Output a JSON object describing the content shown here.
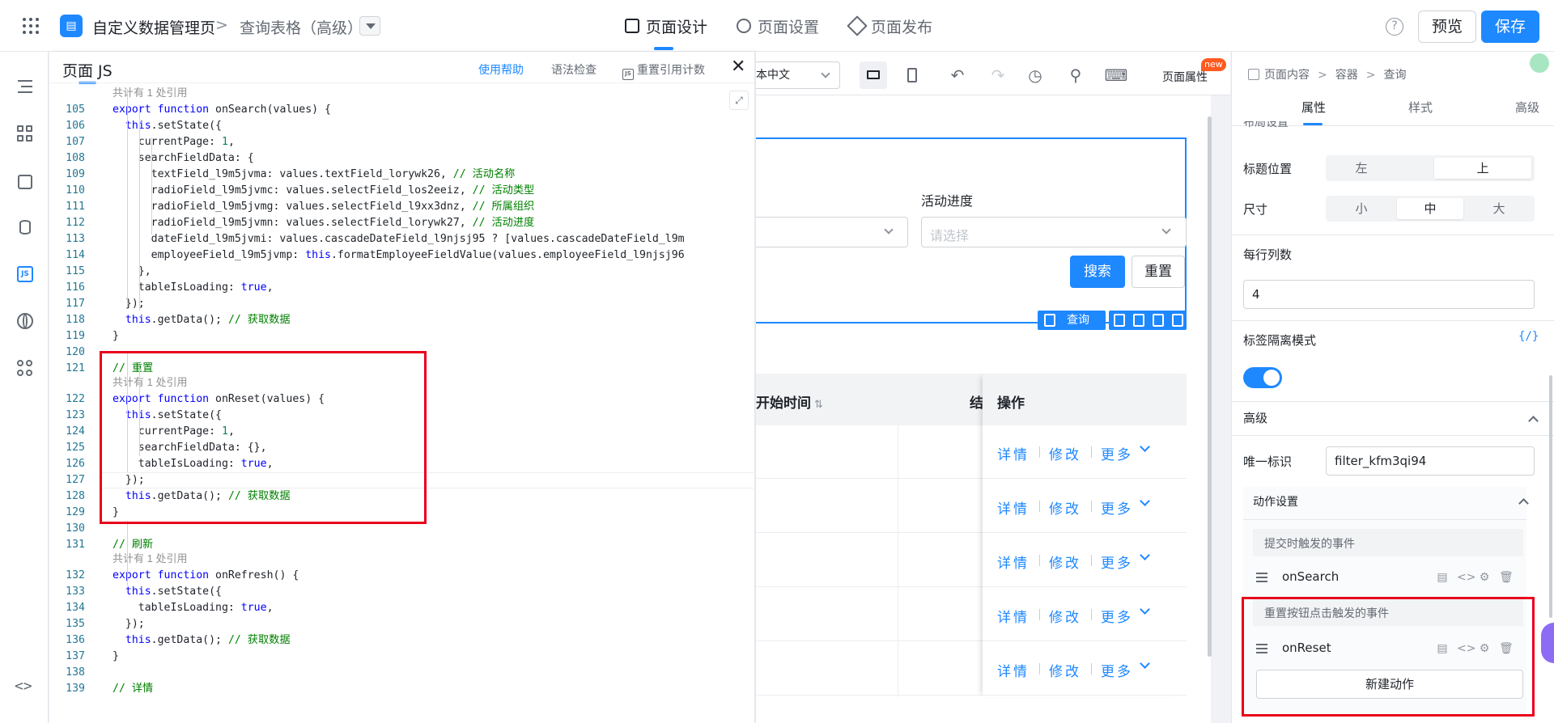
{
  "header": {
    "app_name": "自定义数据管理页",
    "breadcrumb_sep": ">",
    "page_name": "查询表格（高级）",
    "nav": [
      {
        "label": "页面设计",
        "active": true
      },
      {
        "label": "页面设置",
        "active": false
      },
      {
        "label": "页面发布",
        "active": false
      }
    ],
    "help": "?",
    "preview_label": "预览",
    "save_label": "保存"
  },
  "rail": {
    "js_label": "JS",
    "code_label": "<>"
  },
  "code_panel": {
    "title": "页面 JS",
    "help_link": "使用帮助",
    "syntax_check": "语法检查",
    "reset_ref_count": "重置引用计数",
    "js_badge": "JS",
    "close": "✕",
    "lines": [
      {
        "lens": "共计有 1 处引用",
        "n": "105",
        "parts": [
          [
            "k",
            "export function "
          ],
          [
            "t",
            "onSearch(values) {"
          ]
        ]
      },
      {
        "n": "106",
        "parts": [
          [
            "t",
            "  "
          ],
          [
            "k",
            "this"
          ],
          [
            "t",
            ".setState({"
          ]
        ]
      },
      {
        "n": "107",
        "parts": [
          [
            "t",
            "    currentPage: "
          ],
          [
            "n",
            "1"
          ],
          [
            "t",
            ","
          ]
        ]
      },
      {
        "n": "108",
        "parts": [
          [
            "t",
            "    searchFieldData: {"
          ]
        ]
      },
      {
        "n": "109",
        "parts": [
          [
            "t",
            "      textField_l9m5jvma: values.textField_lorywk26, "
          ],
          [
            "c",
            "// 活动名称"
          ]
        ]
      },
      {
        "n": "110",
        "parts": [
          [
            "t",
            "      radioField_l9m5jvmc: values.selectField_los2eeiz, "
          ],
          [
            "c",
            "// 活动类型"
          ]
        ]
      },
      {
        "n": "111",
        "parts": [
          [
            "t",
            "      radioField_l9m5jvmg: values.selectField_l9xx3dnz, "
          ],
          [
            "c",
            "// 所属组织"
          ]
        ]
      },
      {
        "n": "112",
        "parts": [
          [
            "t",
            "      radioField_l9m5jvmn: values.selectField_lorywk27, "
          ],
          [
            "c",
            "// 活动进度"
          ]
        ]
      },
      {
        "n": "113",
        "parts": [
          [
            "t",
            "      dateField_l9m5jvmi: values.cascadeDateField_l9njsj95 ? [values.cascadeDateField_l9m"
          ]
        ]
      },
      {
        "n": "114",
        "parts": [
          [
            "t",
            "      employeeField_l9m5jvmp: "
          ],
          [
            "k",
            "this"
          ],
          [
            "t",
            ".formatEmployeeFieldValue(values.employeeField_l9njsj96"
          ]
        ]
      },
      {
        "n": "115",
        "parts": [
          [
            "t",
            "    },"
          ]
        ]
      },
      {
        "n": "116",
        "parts": [
          [
            "t",
            "    tableIsLoading: "
          ],
          [
            "k",
            "true"
          ],
          [
            "t",
            ","
          ]
        ]
      },
      {
        "n": "117",
        "parts": [
          [
            "t",
            "  });"
          ]
        ]
      },
      {
        "n": "118",
        "parts": [
          [
            "t",
            "  "
          ],
          [
            "k",
            "this"
          ],
          [
            "t",
            ".getData(); "
          ],
          [
            "c",
            "// 获取数据"
          ]
        ]
      },
      {
        "n": "119",
        "parts": [
          [
            "t",
            "}"
          ]
        ]
      },
      {
        "n": "120",
        "parts": []
      },
      {
        "n": "121",
        "parts": [
          [
            "c",
            "// 重置"
          ]
        ]
      },
      {
        "lens": "共计有 1 处引用",
        "n": "122",
        "parts": [
          [
            "k",
            "export function "
          ],
          [
            "t",
            "onReset(values) {"
          ]
        ]
      },
      {
        "n": "123",
        "parts": [
          [
            "t",
            "  "
          ],
          [
            "k",
            "this"
          ],
          [
            "t",
            ".setState({"
          ]
        ]
      },
      {
        "n": "124",
        "parts": [
          [
            "t",
            "    currentPage: "
          ],
          [
            "n",
            "1"
          ],
          [
            "t",
            ","
          ]
        ]
      },
      {
        "n": "125",
        "parts": [
          [
            "t",
            "    searchFieldData: {},"
          ]
        ]
      },
      {
        "n": "126",
        "parts": [
          [
            "t",
            "    tableIsLoading: "
          ],
          [
            "k",
            "true"
          ],
          [
            "t",
            ","
          ]
        ]
      },
      {
        "n": "127",
        "parts": [
          [
            "t",
            "  });"
          ]
        ]
      },
      {
        "n": "128",
        "parts": [
          [
            "t",
            "  "
          ],
          [
            "k",
            "this"
          ],
          [
            "t",
            ".getData(); "
          ],
          [
            "c",
            "// 获取数据"
          ]
        ]
      },
      {
        "n": "129",
        "parts": [
          [
            "t",
            "}"
          ]
        ]
      },
      {
        "n": "130",
        "parts": []
      },
      {
        "n": "131",
        "parts": [
          [
            "c",
            "// 刷新"
          ]
        ]
      },
      {
        "lens": "共计有 1 处引用",
        "n": "132",
        "parts": [
          [
            "k",
            "export function "
          ],
          [
            "t",
            "onRefresh() {"
          ]
        ]
      },
      {
        "n": "133",
        "parts": [
          [
            "t",
            "  "
          ],
          [
            "k",
            "this"
          ],
          [
            "t",
            ".setState({"
          ]
        ]
      },
      {
        "n": "134",
        "parts": [
          [
            "t",
            "    tableIsLoading: "
          ],
          [
            "k",
            "true"
          ],
          [
            "t",
            ","
          ]
        ]
      },
      {
        "n": "135",
        "parts": [
          [
            "t",
            "  });"
          ]
        ]
      },
      {
        "n": "136",
        "parts": [
          [
            "t",
            "  "
          ],
          [
            "k",
            "this"
          ],
          [
            "t",
            ".getData(); "
          ],
          [
            "c",
            "// 获取数据"
          ]
        ]
      },
      {
        "n": "137",
        "parts": [
          [
            "t",
            "}"
          ]
        ]
      },
      {
        "n": "138",
        "parts": []
      },
      {
        "n": "139",
        "parts": [
          [
            "c",
            "// 详情"
          ]
        ]
      }
    ]
  },
  "canvas": {
    "lang_select": "本中文",
    "page_attr": "页面属性",
    "new_badge": "new",
    "filter": {
      "field_label": "活动进度",
      "placeholder": "请选择",
      "search_btn": "搜索",
      "reset_btn": "重置",
      "selection_label": "查询"
    },
    "table": {
      "col_start": "开始时间",
      "col_end": "结",
      "col_ops": "操作",
      "sort_icon": "⇅",
      "rows": [
        {
          "detail": "详情",
          "edit": "修改",
          "more": "更多"
        },
        {
          "detail": "详情",
          "edit": "修改",
          "more": "更多"
        },
        {
          "detail": "详情",
          "edit": "修改",
          "more": "更多"
        },
        {
          "detail": "详情",
          "edit": "修改",
          "more": "更多"
        },
        {
          "detail": "详情",
          "edit": "修改",
          "more": "更多"
        }
      ]
    }
  },
  "props": {
    "breadcrumb": [
      "页面内容",
      "容器",
      "查询"
    ],
    "tabs": [
      {
        "label": "属性",
        "active": true
      },
      {
        "label": "样式",
        "active": false
      },
      {
        "label": "高级",
        "active": false
      }
    ],
    "cut_label": "布局设置",
    "title_position": {
      "label": "标题位置",
      "options": [
        "左",
        "上"
      ],
      "selected": "上"
    },
    "size": {
      "label": "尺寸",
      "options": [
        "小",
        "中",
        "大"
      ],
      "selected": "中"
    },
    "cols_per_row": {
      "label": "每行列数",
      "value": "4"
    },
    "tag_isolation": {
      "label": "标签隔离模式",
      "code_icon": "{/}",
      "enabled": true
    },
    "advanced": {
      "label": "高级"
    },
    "unique_id": {
      "label": "唯一标识",
      "value": "filter_kfm3qi94"
    },
    "actions": {
      "label": "动作设置",
      "groups": [
        {
          "title": "提交时触发的事件",
          "item": "onSearch"
        },
        {
          "title": "重置按钮点击触发的事件",
          "item": "onReset"
        }
      ],
      "new_action": "新建动作"
    }
  },
  "colors": {
    "accent": "#1e88ff",
    "highlight_box": "#e8001c"
  }
}
